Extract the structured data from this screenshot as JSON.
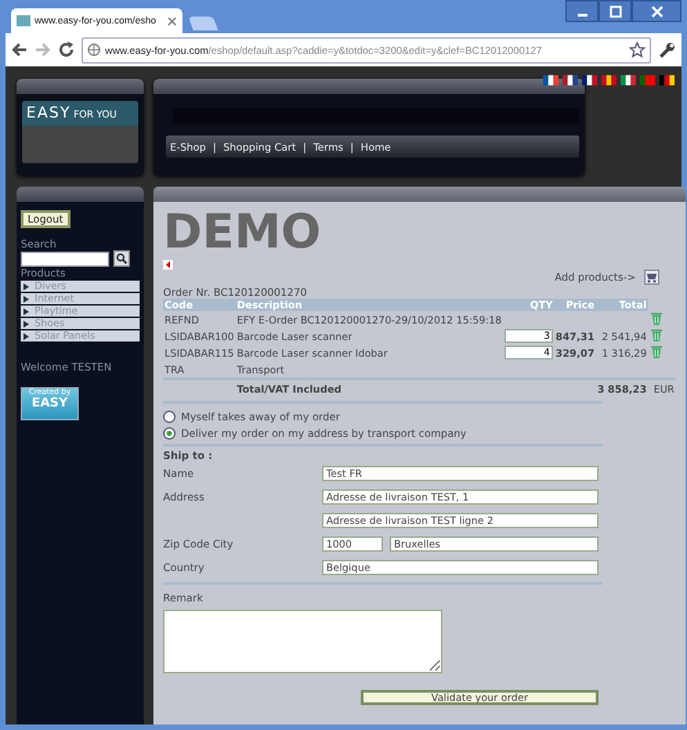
{
  "browser": {
    "tab_title": "www.easy-for-you.com/esho",
    "url_host": "www.easy-for-you.com",
    "url_path": "/eshop/default.asp?caddie=y&totdoc=3200&edit=y&clef=BC12012000127"
  },
  "header": {
    "logo_main": "EASY",
    "logo_sub": "FOR YOU",
    "nav_links": [
      "E-Shop",
      "Shopping Cart",
      "Terms",
      "Home"
    ],
    "nav_separator": "|"
  },
  "sidebar": {
    "logout": "Logout",
    "search_label": "Search",
    "products_label": "Products",
    "products": [
      "Divers",
      "Internet",
      "Playtime",
      "Shoes",
      "Solar Panels"
    ],
    "welcome": "Welcome TESTEN",
    "badge_top": "Created by",
    "badge_main": "EASY"
  },
  "content": {
    "title": "DEMO",
    "add_products": "Add products->",
    "order_nr": "Order Nr. BC120120001270",
    "table": {
      "columns": [
        "Code",
        "Description",
        "QTY",
        "Price",
        "Total"
      ],
      "rows": [
        {
          "code": "REFND",
          "description": "EFY E-Order BC120120001270-29/10/2012 15:59:18",
          "deletable": true
        },
        {
          "code": "LSIDABAR100",
          "description": "Barcode Laser scanner",
          "qty": "3",
          "price": "847,31",
          "total": "2 541,94",
          "deletable": true
        },
        {
          "code": "LSIDABAR115",
          "description": "Barcode Laser scanner Idobar",
          "qty": "4",
          "price": "329,07",
          "total": "1 316,29",
          "deletable": true
        },
        {
          "code": "TRA",
          "description": "Transport",
          "deletable": false
        }
      ],
      "total_label": "Total/VAT Included",
      "total_value": "3 858,23",
      "currency": "EUR"
    },
    "delivery_options": [
      {
        "label": "Myself takes away of my order",
        "selected": false
      },
      {
        "label": "Deliver my order on my address by transport company",
        "selected": true
      }
    ],
    "ship_to": "Ship to :",
    "fields": [
      {
        "label": "Name",
        "values": [
          "Test FR"
        ]
      },
      {
        "label": "Address",
        "values": [
          "Adresse de livraison TEST, 1"
        ]
      },
      {
        "values": [
          "Adresse de livraison TEST ligne 2"
        ]
      },
      {
        "label": "Zip Code City",
        "values": [
          "1000",
          "Bruxelles"
        ]
      },
      {
        "label": "Country",
        "values": [
          "Belgique"
        ]
      }
    ],
    "remark_label": "Remark",
    "submit": "Validate your order"
  }
}
